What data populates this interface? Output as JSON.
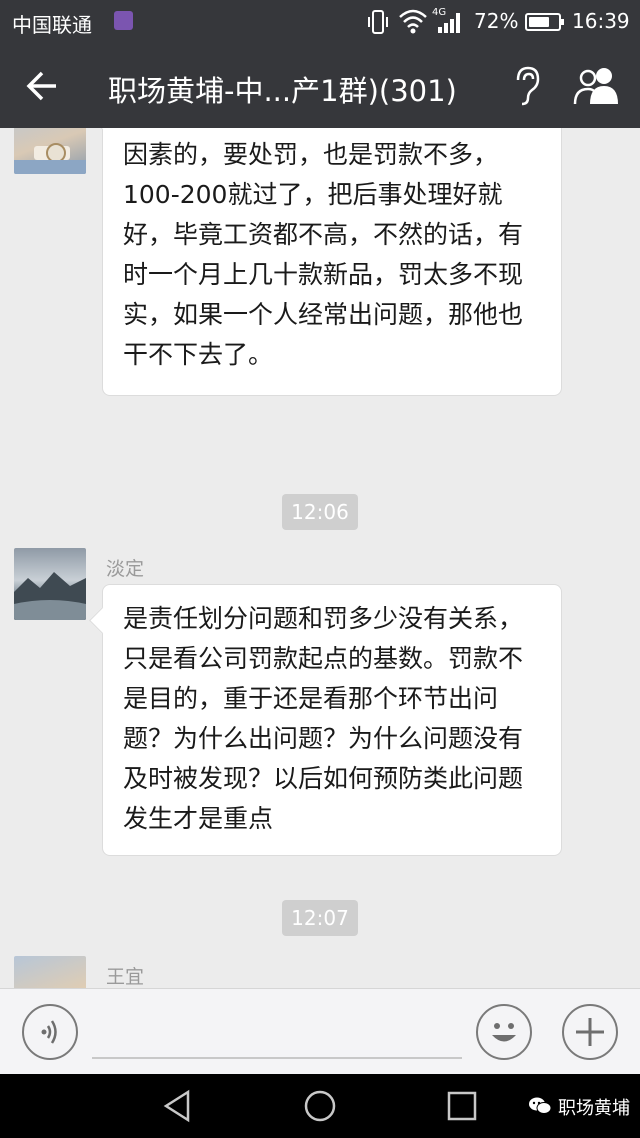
{
  "status_bar": {
    "carrier": "中国联通",
    "network": "4G",
    "battery": "72%",
    "battery_level": 0.72,
    "time": "16:39"
  },
  "nav": {
    "title": "职场黄埔-中...产1群)(301)"
  },
  "messages": [
    {
      "sender": "",
      "text": "对于我们小厂，如果是试产，有很多因素的，要处罚，也是罚款不多，100-200就过了，把后事处理好就好，毕竟工资都不高，不然的话，有时一个月上几十款新品，罚太多不现实，如果一个人经常出问题，那他也干不下去了。"
    },
    {
      "sender": "淡定",
      "text": "是责任划分问题和罚多少没有关系，只是看公司罚款起点的基数。罚款不是目的，重于还是看那个环节出问题？为什么出问题？为什么问题没有及时被发现？以后如何预防类此问题发生才是重点"
    },
    {
      "sender": "王宜",
      "text": ""
    }
  ],
  "timestamps": [
    "12:06",
    "12:07"
  ],
  "watermark": "职场黄埔",
  "colors": {
    "header_bg": "#36373b",
    "chat_bg": "#ececec",
    "bubble_bg": "#ffffff",
    "timestamp_bg": "#cfcfcf"
  },
  "icons": [
    "sim-icon",
    "vibrate-icon",
    "wifi-icon",
    "signal-icon",
    "battery-icon",
    "back-arrow-icon",
    "ear-icon",
    "members-icon",
    "voice-icon",
    "emoji-icon",
    "plus-icon",
    "nav-back-icon",
    "nav-home-icon",
    "nav-recents-icon",
    "wechat-icon"
  ]
}
